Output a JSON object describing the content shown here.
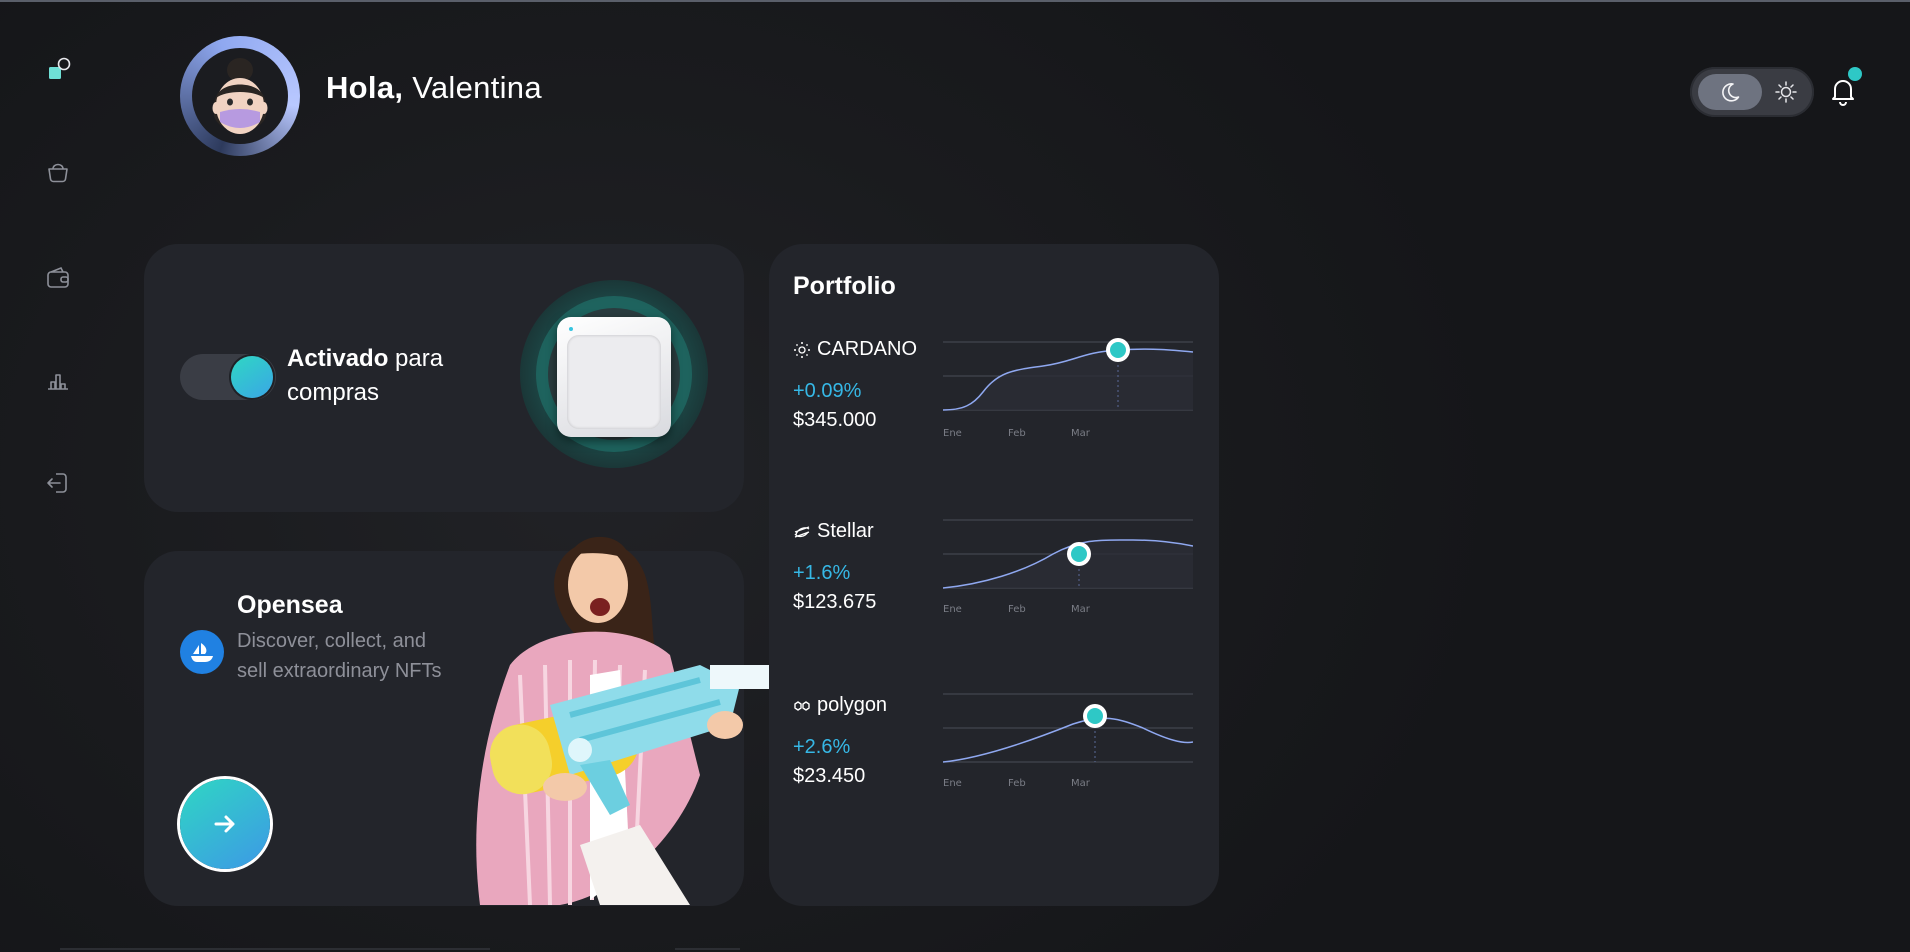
{
  "header": {
    "greeting_bold": "Hola,",
    "greeting_name": " Valentina",
    "theme": {
      "active": "dark"
    },
    "notifications": {
      "has_unread": true
    }
  },
  "sidebar": {
    "items": [
      {
        "icon": "dashboard-icon",
        "active": true
      },
      {
        "icon": "shopping-bag-icon",
        "active": false
      },
      {
        "icon": "wallet-icon",
        "active": false
      },
      {
        "icon": "bar-chart-icon",
        "active": false
      },
      {
        "icon": "logout-icon",
        "active": false
      }
    ]
  },
  "activate_card": {
    "title_bold": "Activado",
    "title_rest": " para compras",
    "switch_on": true
  },
  "opensea_card": {
    "title": "Opensea",
    "description": "Discover, collect, and sell extraordinary NFTs"
  },
  "portfolio": {
    "title": "Portfolio",
    "coins": [
      {
        "name": "CARDANO",
        "change": "+0.09%",
        "price": "$345.000",
        "icon": "cardano-icon"
      },
      {
        "name": "Stellar",
        "change": "+1.6%",
        "price": "$123.675",
        "icon": "stellar-icon"
      },
      {
        "name": "polygon",
        "change": "+2.6%",
        "price": "$23.450",
        "icon": "polygon-icon"
      }
    ],
    "x_ticks": [
      "Ene",
      "Feb",
      "Mar"
    ]
  },
  "colors": {
    "accent": "#2ec8c6",
    "accent_blue": "#36b8e6",
    "card_bg": "#23252b",
    "line": "#8fa8f0"
  }
}
